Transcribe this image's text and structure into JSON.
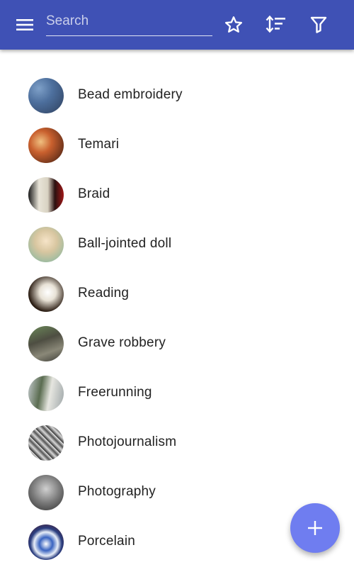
{
  "appbar": {
    "color": "#3f51b5",
    "menu_icon": "menu-icon",
    "search": {
      "value": "",
      "placeholder": "Search"
    },
    "actions": [
      {
        "name": "favorites",
        "icon": "star-outline-icon"
      },
      {
        "name": "sort",
        "icon": "sort-icon"
      },
      {
        "name": "filter",
        "icon": "filter-icon"
      }
    ]
  },
  "list": {
    "items": [
      {
        "label": "Bead embroidery"
      },
      {
        "label": "Temari"
      },
      {
        "label": "Braid"
      },
      {
        "label": "Ball-jointed doll"
      },
      {
        "label": "Reading"
      },
      {
        "label": "Grave robbery"
      },
      {
        "label": "Freerunning"
      },
      {
        "label": "Photojournalism"
      },
      {
        "label": "Photography"
      },
      {
        "label": "Porcelain"
      }
    ]
  },
  "fab": {
    "icon": "plus-icon",
    "color": "#6f7df0"
  }
}
